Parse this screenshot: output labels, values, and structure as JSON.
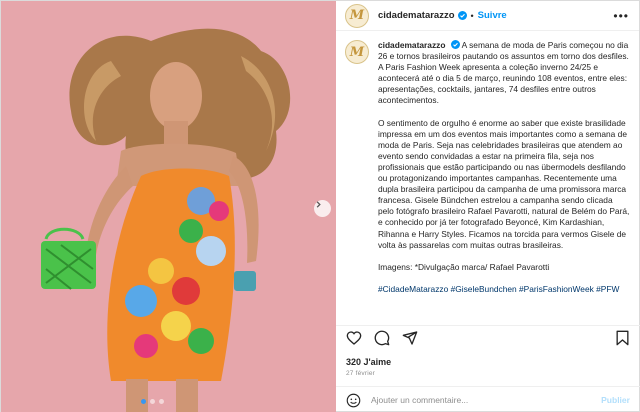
{
  "post": {
    "username": "cidadematarazzo",
    "separator": "•",
    "follow_label": "Suivre",
    "avatar_letter": "M",
    "more_label": "•••",
    "caption": {
      "username": "cidadematarazzo",
      "paragraph_1": "A semana de moda de Paris começou no dia 26 e tornos brasileiros pautando os assuntos em torno dos desfiles. A Paris Fashion Week apresenta a coleção inverno 24/25 e acontecerá até o dia 5 de março, reunindo 108 eventos, entre eles: apresentações, cocktails, jantares, 74 desfiles entre outros acontecimentos.",
      "paragraph_2": "O sentimento de orgulho é enorme ao saber que existe brasilidade impressa em um dos eventos mais importantes como a semana de moda de Paris. Seja nas celebridades brasileiras que atendem ao evento sendo convidadas a estar na primeira fila, seja nos profissionais que estão participando ou nas übermodels desfilando ou protagonizando importantes campanhas. Recentemente uma dupla brasileira participou da campanha de uma promissora marca francesa. Gisele Bündchen estrelou a campanha sendo clicada pelo fotógrafo brasileiro Rafael Pavarotti, natural de Belém do Pará, e conhecido por já ter fotografado Beyoncé, Kim Kardashian, Rihanna e Harry Styles. Ficamos na torcida para vermos Gisele de volta às passarelas com muitas outras brasileiras.",
      "credits": "Imagens: *Divulgação marca/ Rafael Pavarotti",
      "hashtags": "#CidadeMatarazzo #GiseleBundchen #ParisFashionWeek #PFW"
    },
    "likes": "320 J'aime",
    "date": "27 février",
    "comment_placeholder": "Ajouter un commentaire...",
    "publish_label": "Publier",
    "carousel_slide": 1,
    "carousel_total": 3
  },
  "colors": {
    "link_blue": "#0095f6",
    "photo_bg": "#e6a6ab",
    "dress": "#f08a2c"
  },
  "icons": [
    "verified-icon",
    "more-icon",
    "heart-icon",
    "comment-icon",
    "share-icon",
    "bookmark-icon",
    "emoji-icon",
    "chevron-right-icon"
  ]
}
